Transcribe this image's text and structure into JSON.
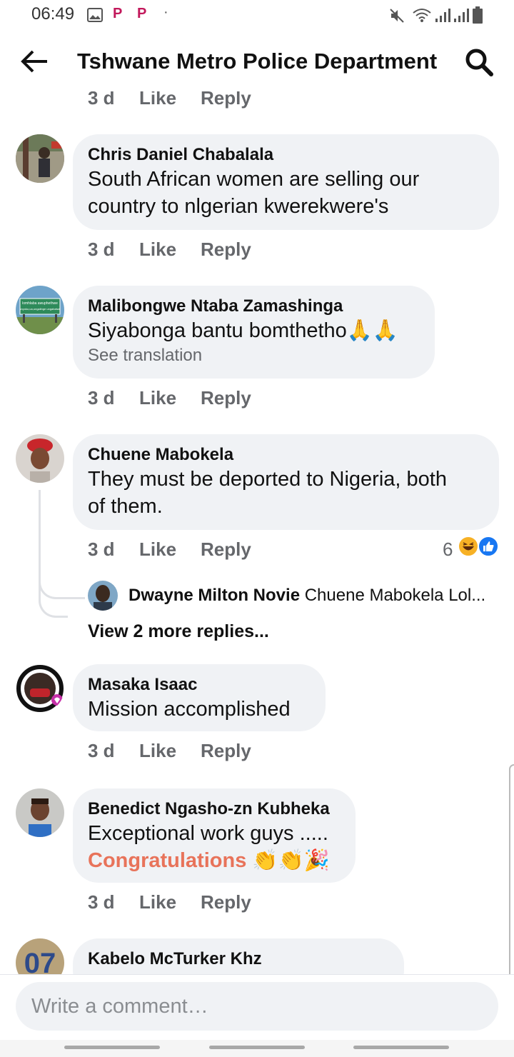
{
  "status_bar": {
    "time": "06:49",
    "icons": [
      "image-icon",
      "p-app-icon",
      "p-app-icon",
      "dot-icon",
      "mute-icon",
      "wifi-icon",
      "signal-icon",
      "signal-icon",
      "battery-icon"
    ]
  },
  "header": {
    "title": "Tshwane Metro Police Department",
    "back_icon": "arrow-left-icon",
    "search_icon": "search-icon"
  },
  "partial_actions": {
    "time": "3 d",
    "like": "Like",
    "reply": "Reply"
  },
  "comments": [
    {
      "author": "Chris Daniel Chabalala",
      "lines": [
        "South African women are selling our",
        "country to nlgerian kwerekwere's"
      ],
      "time": "3 d",
      "like": "Like",
      "reply": "Reply"
    },
    {
      "author": "Malibongwe Ntaba Zamashinga",
      "lines": [
        "Siyabonga bantu bomthetho🙏🙏"
      ],
      "see_translation": "See translation",
      "time": "3 d",
      "like": "Like",
      "reply": "Reply",
      "avatar_sign": [
        "lomhlaba awuphethwe",
        "unyoko,ua,ungalinge ungabalwe"
      ]
    },
    {
      "author": "Chuene Mabokela",
      "lines": [
        "They must be deported to Nigeria, both",
        "of them."
      ],
      "time": "3 d",
      "like": "Like",
      "reply": "Reply",
      "reaction_count": "6",
      "reaction_icons": [
        "haha-icon",
        "like-reaction-icon"
      ]
    },
    {
      "author": "Masaka Isaac",
      "lines": [
        "Mission accomplished"
      ],
      "time": "3 d",
      "like": "Like",
      "reply": "Reply",
      "avatar_badge": "I GOT MY COVID-19 VACCINE"
    },
    {
      "author": "Benedict Ngasho-zn Kubheka",
      "lines": [
        "Exceptional work guys ....."
      ],
      "congrats": "Congratulations",
      "congrats_emoji": "👏👏🎉",
      "time": "3 d",
      "like": "Like",
      "reply": "Reply"
    },
    {
      "author": "Kabelo McTurker Khz",
      "avatar_text": "07"
    }
  ],
  "reply_preview": {
    "author": "Dwayne Milton Novie",
    "text": "Chuene Mabokela Lol...",
    "view_more": "View 2 more replies..."
  },
  "composer": {
    "placeholder": "Write a comment…"
  },
  "colors": {
    "bubble": "#f0f2f5",
    "secondary_text": "#65676b",
    "congrats": "#e8735a",
    "like_blue": "#1877f2"
  }
}
